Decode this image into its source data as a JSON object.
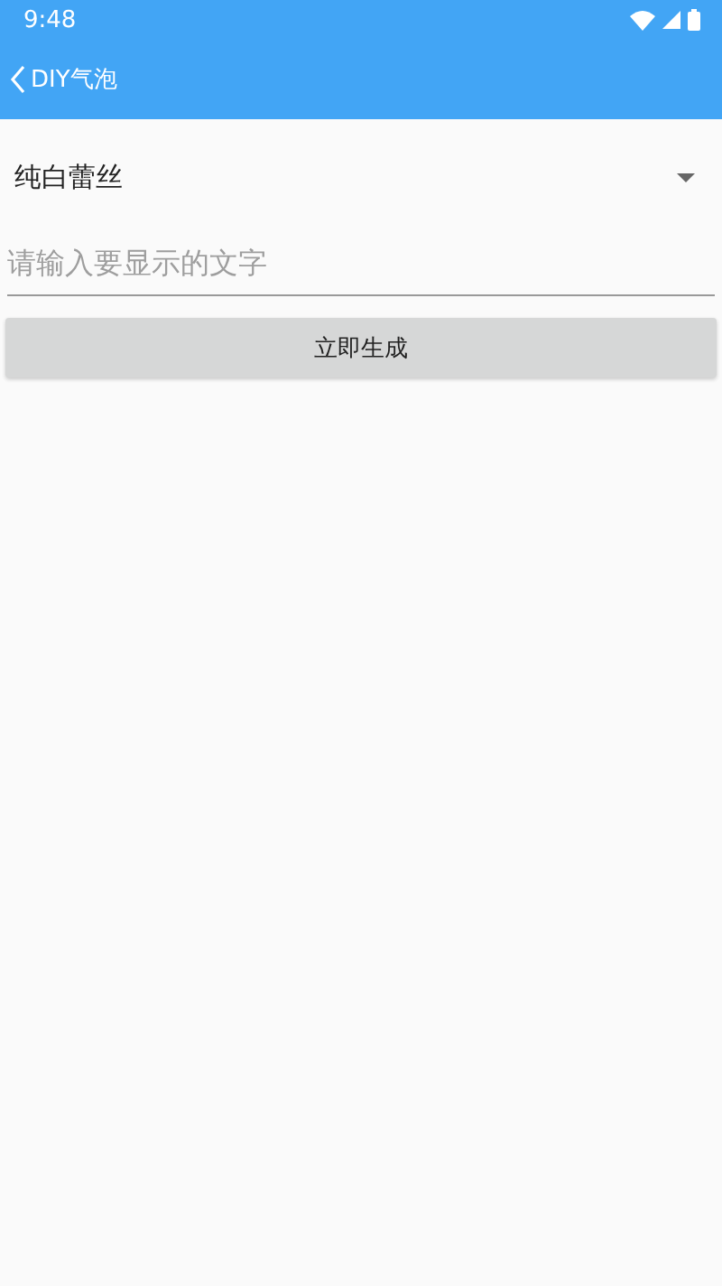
{
  "status_bar": {
    "time": "9:48"
  },
  "app_bar": {
    "title": "DIY气泡"
  },
  "dropdown": {
    "value": "纯白蕾丝"
  },
  "text_input": {
    "placeholder": "请输入要显示的文字"
  },
  "button": {
    "label": "立即生成"
  }
}
